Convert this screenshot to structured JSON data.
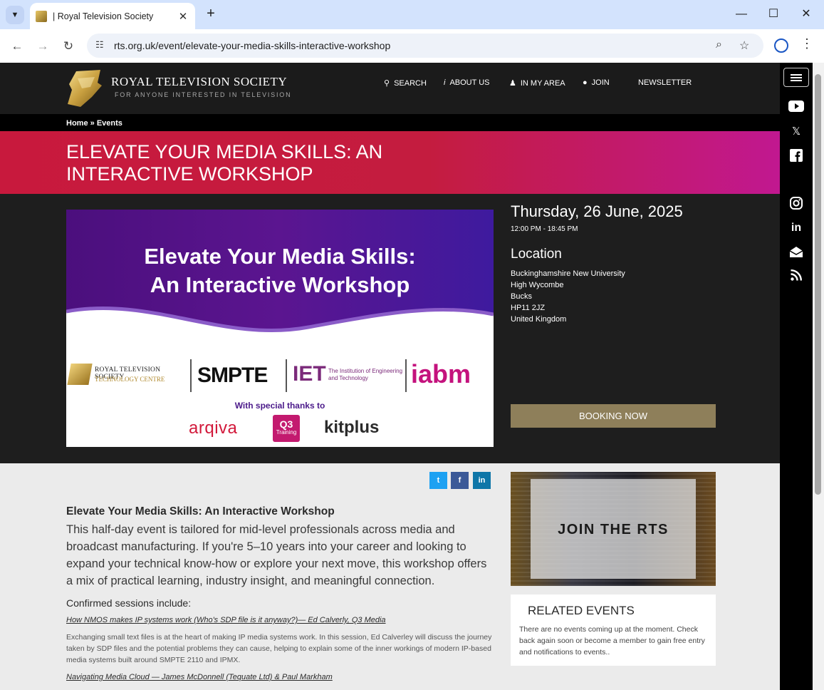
{
  "browser": {
    "tab_title": "| Royal Television Society",
    "url": "rts.org.uk/event/elevate-your-media-skills-interactive-workshop"
  },
  "header": {
    "logo_title": "ROYAL TELEVISION SOCIETY",
    "logo_subtitle": "FOR ANYONE INTERESTED IN TELEVISION",
    "nav": {
      "search": "SEARCH",
      "about": "ABOUT US",
      "area": "IN MY AREA",
      "join": "JOIN",
      "newsletter": "NEWSLETTER"
    }
  },
  "breadcrumb": {
    "home": "Home",
    "separator": "»",
    "events": "Events"
  },
  "banner": {
    "title": "ELEVATE YOUR MEDIA SKILLS: AN INTERACTIVE WORKSHOP"
  },
  "promo": {
    "heading_line1": "Elevate Your Media Skills:",
    "heading_line2": "An Interactive Workshop",
    "rts_line1": "ROYAL TELEVISION SOCIETY",
    "rts_line2": "TECHNOLOGY CENTRE",
    "smpte": "SMPTE",
    "iet": "IET",
    "iet_sub": "The Institution of Engineering and Technology",
    "iabm": "iabm",
    "thanks": "With special thanks to",
    "arqiva": "arqiva",
    "q3_top": "Q3",
    "q3_bottom": "Training",
    "kitplus": "kitplus"
  },
  "event": {
    "date": "Thursday, 26 June, 2025",
    "time": "12:00 PM - 18:45 PM",
    "location_heading": "Location",
    "address": [
      "Buckinghamshire New University",
      "High Wycombe",
      "Bucks",
      "HP11 2JZ",
      "United Kingdom"
    ],
    "booking_label": "BOOKING NOW"
  },
  "share": {
    "twitter": "t",
    "facebook": "f",
    "linkedin": "in"
  },
  "content": {
    "heading": "Elevate Your Media Skills: An Interactive Workshop",
    "intro": "This half-day event is tailored for mid-level professionals across media and broadcast manufacturing. If you're 5–10 years into your career and looking to expand your technical know-how or explore your next move, this workshop offers a mix of practical learning, industry insight, and meaningful connection.",
    "sessions_heading": "Confirmed sessions include:",
    "session1_link": "How NMOS makes IP systems work (Who's SDP file is it anyway?)— Ed Calverly, Q3 Media",
    "session1_text": "Exchanging small text files is at the heart of making IP media systems work. In this session, Ed Calverley will discuss the journey taken by SDP files and the potential problems they can cause, helping to explain some of the inner workings of modern IP-based media systems built around SMPTE 2110 and IPMX.",
    "session2_link": "Navigating Media Cloud — James McDonnell (Tequate Ltd) & Paul Markham"
  },
  "sidebar": {
    "join_text": "JOIN THE RTS",
    "related_heading": "RELATED EVENTS",
    "related_text": "There are no events coming up at the moment. Check back again soon or become a member to gain free entry and notifications to events.."
  },
  "social": [
    "youtube-icon",
    "x-icon",
    "facebook-icon",
    "instagram-icon",
    "linkedin-icon",
    "mail-icon",
    "rss-icon"
  ]
}
